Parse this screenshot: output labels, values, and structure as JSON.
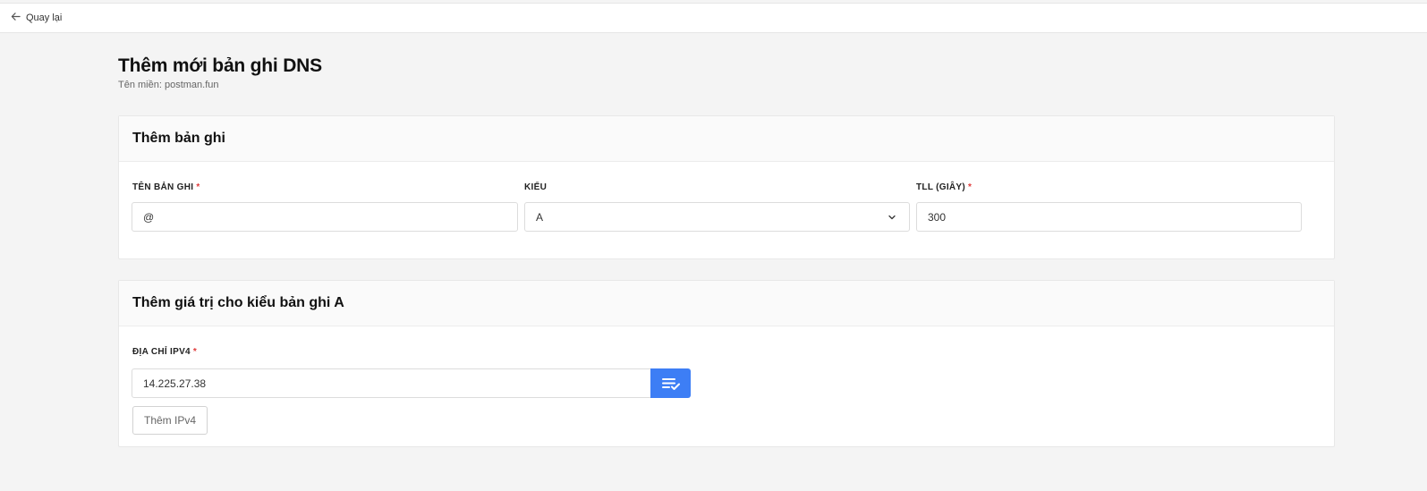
{
  "topbar": {
    "back_label": "Quay lại"
  },
  "page": {
    "title": "Thêm mới bản ghi DNS",
    "subtitle": "Tên miền: postman.fun"
  },
  "record_card": {
    "title": "Thêm bản ghi",
    "name_label": "TÊN BẢN GHI",
    "name_value": "@",
    "type_label": "KIỂU",
    "type_value": "A",
    "ttl_label": "TLL (GIÂY)",
    "ttl_value": "300",
    "required_mark": "*"
  },
  "value_card": {
    "title": "Thêm giá trị cho kiểu bản ghi A",
    "ipv4_label": "ĐỊA CHỈ IPV4",
    "ipv4_value": "14.225.27.38",
    "add_button_label": "Thêm IPv4",
    "required_mark": "*"
  },
  "icons": {
    "back": "arrow-left-icon",
    "select": "chevron-down-icon",
    "confirm": "list-check-icon"
  },
  "colors": {
    "accent": "#3d7ef5",
    "required": "#e03b3b",
    "background": "#f4f4f4"
  }
}
